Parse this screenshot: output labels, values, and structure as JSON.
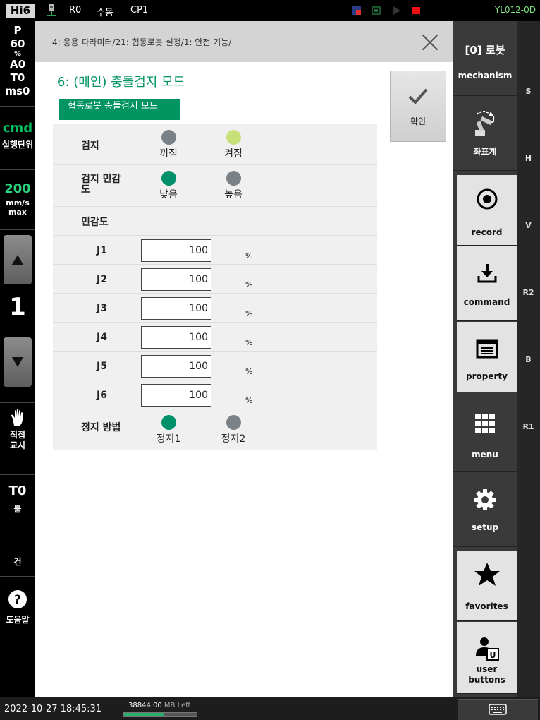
{
  "topbar": {
    "logo": "Hi6",
    "robot": "R0",
    "mode": "수동",
    "program": "CP1",
    "system_name": "YL012-0D",
    "icons": [
      "usb-icon",
      "error-indicator-icon",
      "stop-indicator-icon",
      "play-indicator-icon",
      "record-indicator-icon"
    ]
  },
  "left_panel": {
    "status": [
      "P",
      "60",
      "%",
      "A0",
      "T0",
      "ms0"
    ],
    "cmd_label": "cmd",
    "cmd_sub": "실행단위",
    "speed_value": "200",
    "speed_unit": "mm/s",
    "speed_mode": "max",
    "step_value": "1",
    "direct_teach_label": "직접\n교시",
    "tool_value": "T0",
    "tool_label": "툴",
    "gun_label": "건",
    "help_label": "도움말",
    "colors": {
      "cmd": "#00c060",
      "speed": "#28d37e"
    }
  },
  "main": {
    "breadcrumb": "4: 응용 파라미터/21: 협동로봇 설정/1: 안전 기능/",
    "page_title": "6: (메인) 충돌검지 모드",
    "confirm_label": "확인",
    "section_tag": "협동로봇 충돌검지 모드",
    "detection": {
      "label": "검지",
      "options": [
        {
          "label": "꺼짐",
          "selected": false,
          "color": "#7a8287"
        },
        {
          "label": "켜짐",
          "selected": true,
          "color": "#c8e07a"
        }
      ]
    },
    "sensitivity_level": {
      "label": "검지 민감\n도",
      "options": [
        {
          "label": "낮음",
          "selected": true,
          "color": "#00916a"
        },
        {
          "label": "높음",
          "selected": false,
          "color": "#7a8287"
        }
      ]
    },
    "sensitivity_label": "민감도",
    "joints": [
      {
        "name": "J1",
        "value": "100",
        "unit": "%"
      },
      {
        "name": "J2",
        "value": "100",
        "unit": "%"
      },
      {
        "name": "J3",
        "value": "100",
        "unit": "%"
      },
      {
        "name": "J4",
        "value": "100",
        "unit": "%"
      },
      {
        "name": "J5",
        "value": "100",
        "unit": "%"
      },
      {
        "name": "J6",
        "value": "100",
        "unit": "%"
      }
    ],
    "stop_method": {
      "label": "정지 방법",
      "options": [
        {
          "label": "정지1",
          "selected": true,
          "color": "#00916a"
        },
        {
          "label": "정지2",
          "selected": false,
          "color": "#7a8287"
        }
      ]
    }
  },
  "right_nav": {
    "robot_label": "[0] 로봇",
    "items": [
      {
        "label": "mechanism",
        "icon": "mechanism-icon"
      },
      {
        "label": "좌표계",
        "icon": "coordinate-robot-icon"
      },
      {
        "label": "record",
        "icon": "record-icon"
      },
      {
        "label": "command",
        "icon": "download-icon"
      },
      {
        "label": "property",
        "icon": "window-icon"
      },
      {
        "label": "menu",
        "icon": "grid-icon"
      },
      {
        "label": "setup",
        "icon": "gear-icon"
      },
      {
        "label": "favorites",
        "icon": "star-icon"
      },
      {
        "label": "user\nbuttons",
        "icon": "user-icon"
      }
    ]
  },
  "side_strip": {
    "labels": [
      "S",
      "H",
      "V",
      "R2",
      "B",
      "R1"
    ]
  },
  "bottombar": {
    "datetime": "2022-10-27 18:45:31",
    "memory_value": "38844.00",
    "memory_suffix": "MB Left",
    "memory_fill": 0.55
  }
}
